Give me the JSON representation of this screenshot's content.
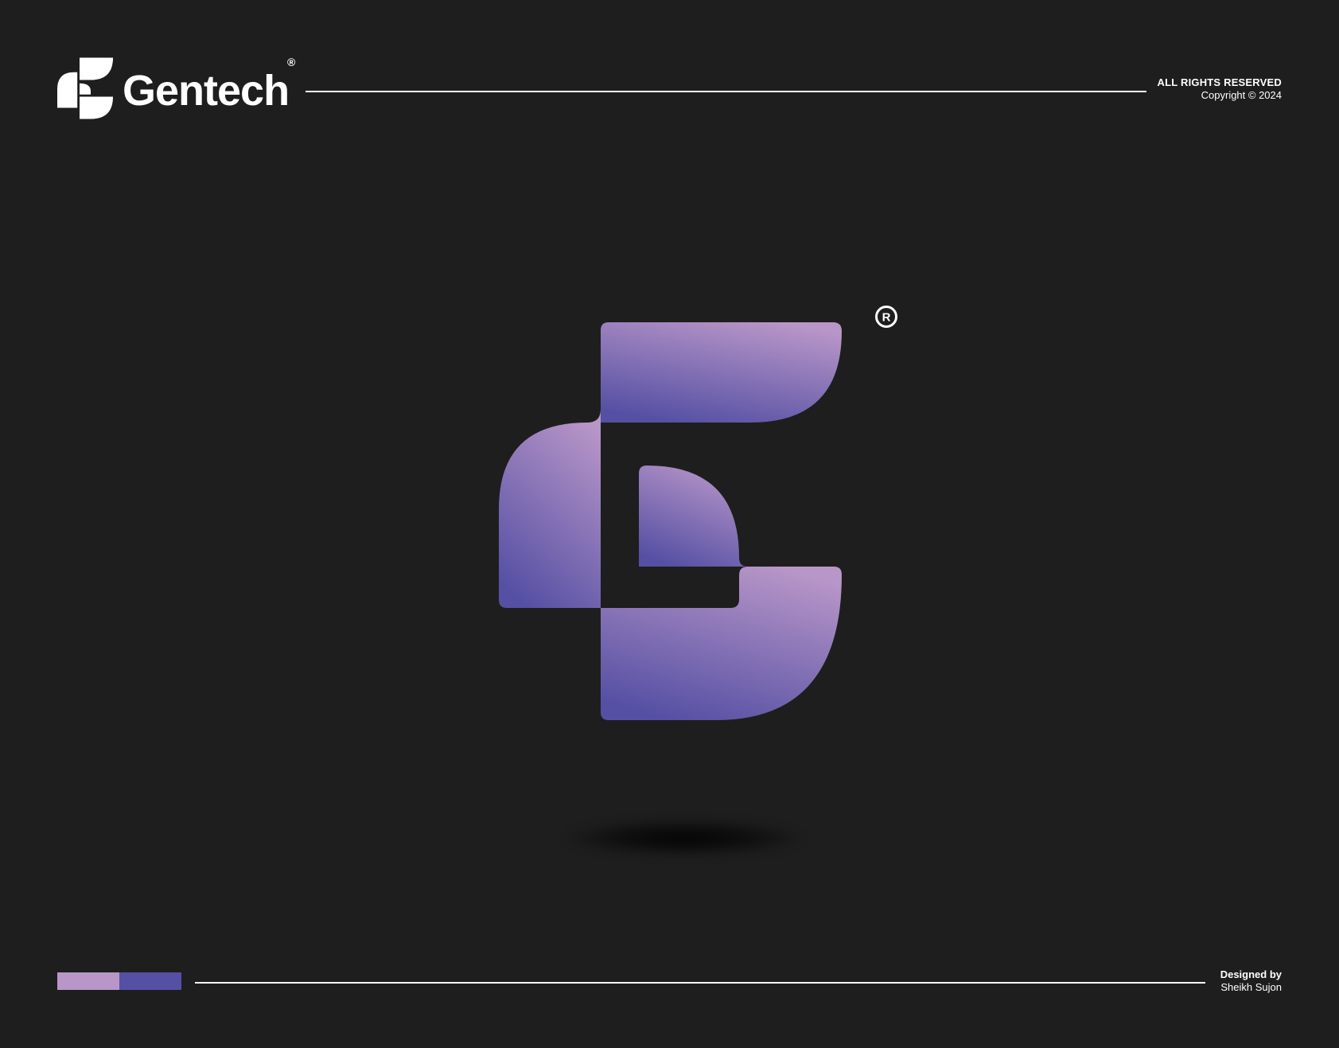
{
  "brand": {
    "name": "Gentech",
    "registered_mark": "®"
  },
  "header": {
    "rights_title": "ALL RIGHTS RESERVED",
    "copyright": "Copyright © 2024"
  },
  "footer": {
    "credit_title": "Designed by",
    "credit_name": "Sheikh Sujon"
  },
  "colors": {
    "background": "#1e1e1e",
    "gradient_light": "#b896c8",
    "gradient_dark": "#5650a4",
    "palette": [
      "#b896c8",
      "#5650a4"
    ]
  },
  "icons": {
    "brand_mark": "gentech-g-logo-icon",
    "main_logo": "gentech-g-logo-icon",
    "registered": "registered-trademark-icon"
  }
}
